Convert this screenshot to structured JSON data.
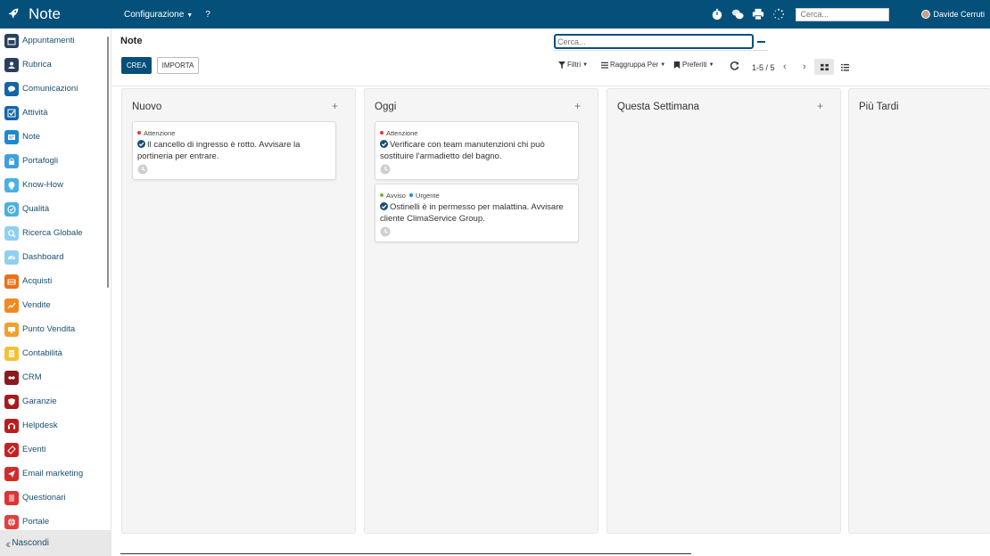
{
  "app": {
    "title": "Note",
    "menu_configurazione": "Configurazione",
    "menu_help": "?",
    "search_placeholder": "Cerca...",
    "user_name": "Davide Cerruti"
  },
  "sidebar": {
    "items": [
      {
        "label": "Appuntamenti",
        "icon": "calendar-icon",
        "color": "#2a3f5f"
      },
      {
        "label": "Rubrica",
        "icon": "contacts-icon",
        "color": "#2a3f5f"
      },
      {
        "label": "Comunicazioni",
        "icon": "chat-icon",
        "color": "#1565a8"
      },
      {
        "label": "Attività",
        "icon": "checkbox-icon",
        "color": "#1565a8"
      },
      {
        "label": "Note",
        "icon": "note-icon",
        "color": "#1e88d0"
      },
      {
        "label": "Portafogli",
        "icon": "lock-icon",
        "color": "#3ea0dc"
      },
      {
        "label": "Know-How",
        "icon": "head-icon",
        "color": "#4ab0e4"
      },
      {
        "label": "Qualità",
        "icon": "quality-icon",
        "color": "#4ab0e4"
      },
      {
        "label": "Ricerca Globale",
        "icon": "magnifier-icon",
        "color": "#8fd0f0"
      },
      {
        "label": "Dashboard",
        "icon": "gauge-icon",
        "color": "#8fd0f0"
      },
      {
        "label": "Acquisti",
        "icon": "cart-icon",
        "color": "#e8711a"
      },
      {
        "label": "Vendite",
        "icon": "chart-icon",
        "color": "#ef8a1e"
      },
      {
        "label": "Punto Vendita",
        "icon": "monitor-icon",
        "color": "#f2a02a"
      },
      {
        "label": "Contabilità",
        "icon": "document-icon",
        "color": "#f5c032"
      },
      {
        "label": "CRM",
        "icon": "crm-icon",
        "color": "#8b1a1a"
      },
      {
        "label": "Garanzie",
        "icon": "shield-icon",
        "color": "#a51c1c"
      },
      {
        "label": "Helpdesk",
        "icon": "headset-icon",
        "color": "#b81e1e"
      },
      {
        "label": "Eventi",
        "icon": "ticket-icon",
        "color": "#c82020"
      },
      {
        "label": "Email marketing",
        "icon": "paper-plane-icon",
        "color": "#d42a2a"
      },
      {
        "label": "Questionari",
        "icon": "list-icon",
        "color": "#dc3434"
      },
      {
        "label": "Portale",
        "icon": "globe-icon",
        "color": "#e04040"
      }
    ],
    "footer_label": "Nascondi"
  },
  "control_panel": {
    "breadcrumb": "Note",
    "create_button": "CREA",
    "import_button": "IMPORTA",
    "search_placeholder": "Cerca...",
    "filters_label": "Filtri",
    "group_by_label": "Raggruppa Per",
    "favorites_label": "Preferiti",
    "pager_value": "1-5 / 5"
  },
  "kanban": {
    "columns": [
      {
        "title": "Nuovo",
        "add_symbol": "+",
        "cards": [
          {
            "tags": [
              {
                "label": "Attenzione",
                "color": "#e53935"
              }
            ],
            "text": "Il cancello di ingresso è rotto. Avvisare la portineria per entrare."
          }
        ]
      },
      {
        "title": "Oggi",
        "add_symbol": "+",
        "cards": [
          {
            "tags": [
              {
                "label": "Attenzione",
                "color": "#e53935"
              }
            ],
            "text": "Verificare con team manutenzioni chi può sostituire l'armadietto del bagno."
          },
          {
            "tags": [
              {
                "label": "Avviso",
                "color": "#7cb342"
              },
              {
                "label": "Urgente",
                "color": "#1e88e5"
              }
            ],
            "text": "Ostinelli è in permesso per malattina. Avvisare cliente ClimaService Group."
          }
        ]
      },
      {
        "title": "Questa Settimana",
        "add_symbol": "+",
        "cards": []
      },
      {
        "title": "Più Tardi",
        "add_symbol": "",
        "cards": []
      }
    ]
  },
  "colors": {
    "brand": "#05507a",
    "sidebar_text": "#1a4f72",
    "column_bg": "#f5f5f5"
  }
}
